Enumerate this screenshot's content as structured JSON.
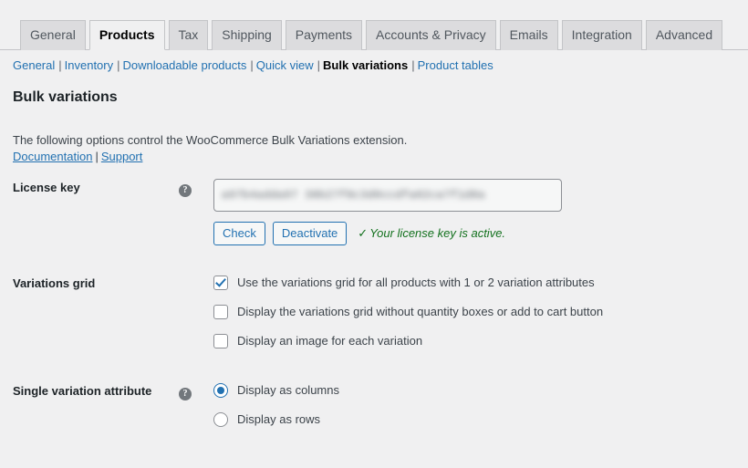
{
  "tabs": [
    {
      "label": "General",
      "active": false
    },
    {
      "label": "Products",
      "active": true
    },
    {
      "label": "Tax",
      "active": false
    },
    {
      "label": "Shipping",
      "active": false
    },
    {
      "label": "Payments",
      "active": false
    },
    {
      "label": "Accounts & Privacy",
      "active": false
    },
    {
      "label": "Emails",
      "active": false
    },
    {
      "label": "Integration",
      "active": false
    },
    {
      "label": "Advanced",
      "active": false
    }
  ],
  "subnav": {
    "separator": "|",
    "items": [
      {
        "label": "General",
        "current": false
      },
      {
        "label": "Inventory",
        "current": false
      },
      {
        "label": "Downloadable products",
        "current": false
      },
      {
        "label": "Quick view",
        "current": false
      },
      {
        "label": "Bulk variations",
        "current": true
      },
      {
        "label": "Product tables",
        "current": false
      }
    ]
  },
  "section": {
    "title": "Bulk variations",
    "description": "The following options control the WooCommerce Bulk Variations extension.",
    "links": [
      {
        "label": "Documentation"
      },
      {
        "label": "Support"
      }
    ],
    "links_separator": "|"
  },
  "license": {
    "label": "License key",
    "help_icon": "help-icon",
    "value": "a97b4adda97 38b27f8c3d0ccdfa02ca7f1d8a",
    "check_label": "Check",
    "deactivate_label": "Deactivate",
    "status_tick": "✓",
    "status_text": "Your license key is active.",
    "status_color": "#13711e"
  },
  "variations_grid": {
    "label": "Variations grid",
    "options": [
      {
        "label": "Use the variations grid for all products with 1 or 2 variation attributes",
        "checked": true
      },
      {
        "label": "Display the variations grid without quantity boxes or add to cart button",
        "checked": false
      },
      {
        "label": "Display an image for each variation",
        "checked": false
      }
    ]
  },
  "single_variation_attribute": {
    "label": "Single variation attribute",
    "help_icon": "help-icon",
    "options": [
      {
        "label": "Display as columns",
        "selected": true
      },
      {
        "label": "Display as rows",
        "selected": false
      }
    ]
  },
  "colors": {
    "background": "#f0f0f1",
    "accent": "#2271b1",
    "tab_inactive": "#dcdcde",
    "success": "#13711e"
  },
  "icons": {
    "help": "?"
  }
}
